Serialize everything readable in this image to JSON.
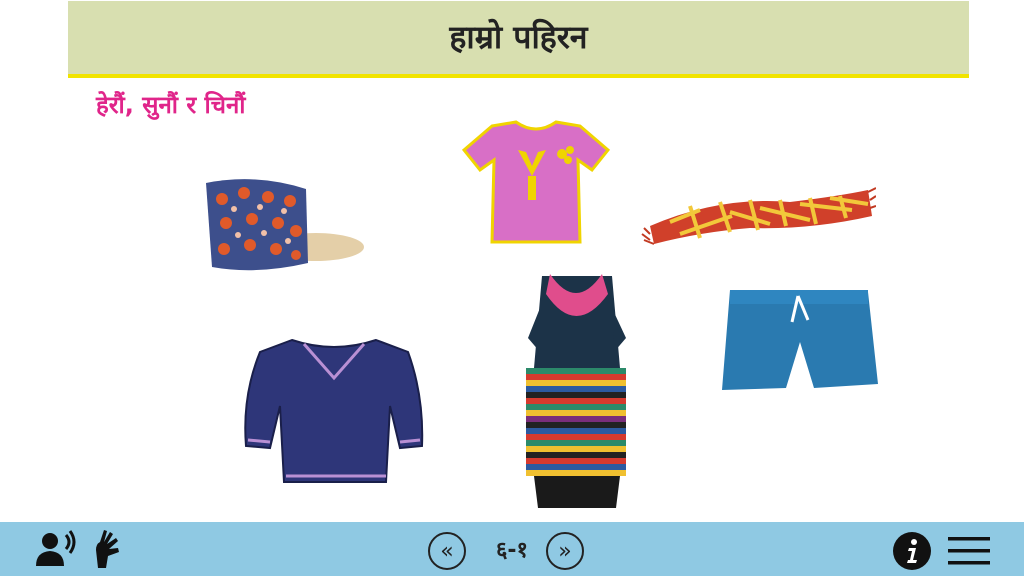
{
  "header": {
    "title": "हाम्रो पहिरन"
  },
  "instruction": "हेरौं, सुनौं र चिनौं",
  "items": [
    {
      "name": "topi-cap"
    },
    {
      "name": "pink-tshirt"
    },
    {
      "name": "checked-scarf"
    },
    {
      "name": "blue-sweater"
    },
    {
      "name": "traditional-dress"
    },
    {
      "name": "blue-shorts"
    }
  ],
  "footer": {
    "page_number": "६-१",
    "prev_label": "«",
    "next_label": "»",
    "icons": [
      "audio-icon",
      "sign-language-icon",
      "info-icon",
      "menu-icon"
    ]
  },
  "colors": {
    "title_bg": "#d8dfb0",
    "title_border": "#f1e400",
    "instruction": "#e0258a",
    "footer_bg": "#8fc9e3"
  }
}
